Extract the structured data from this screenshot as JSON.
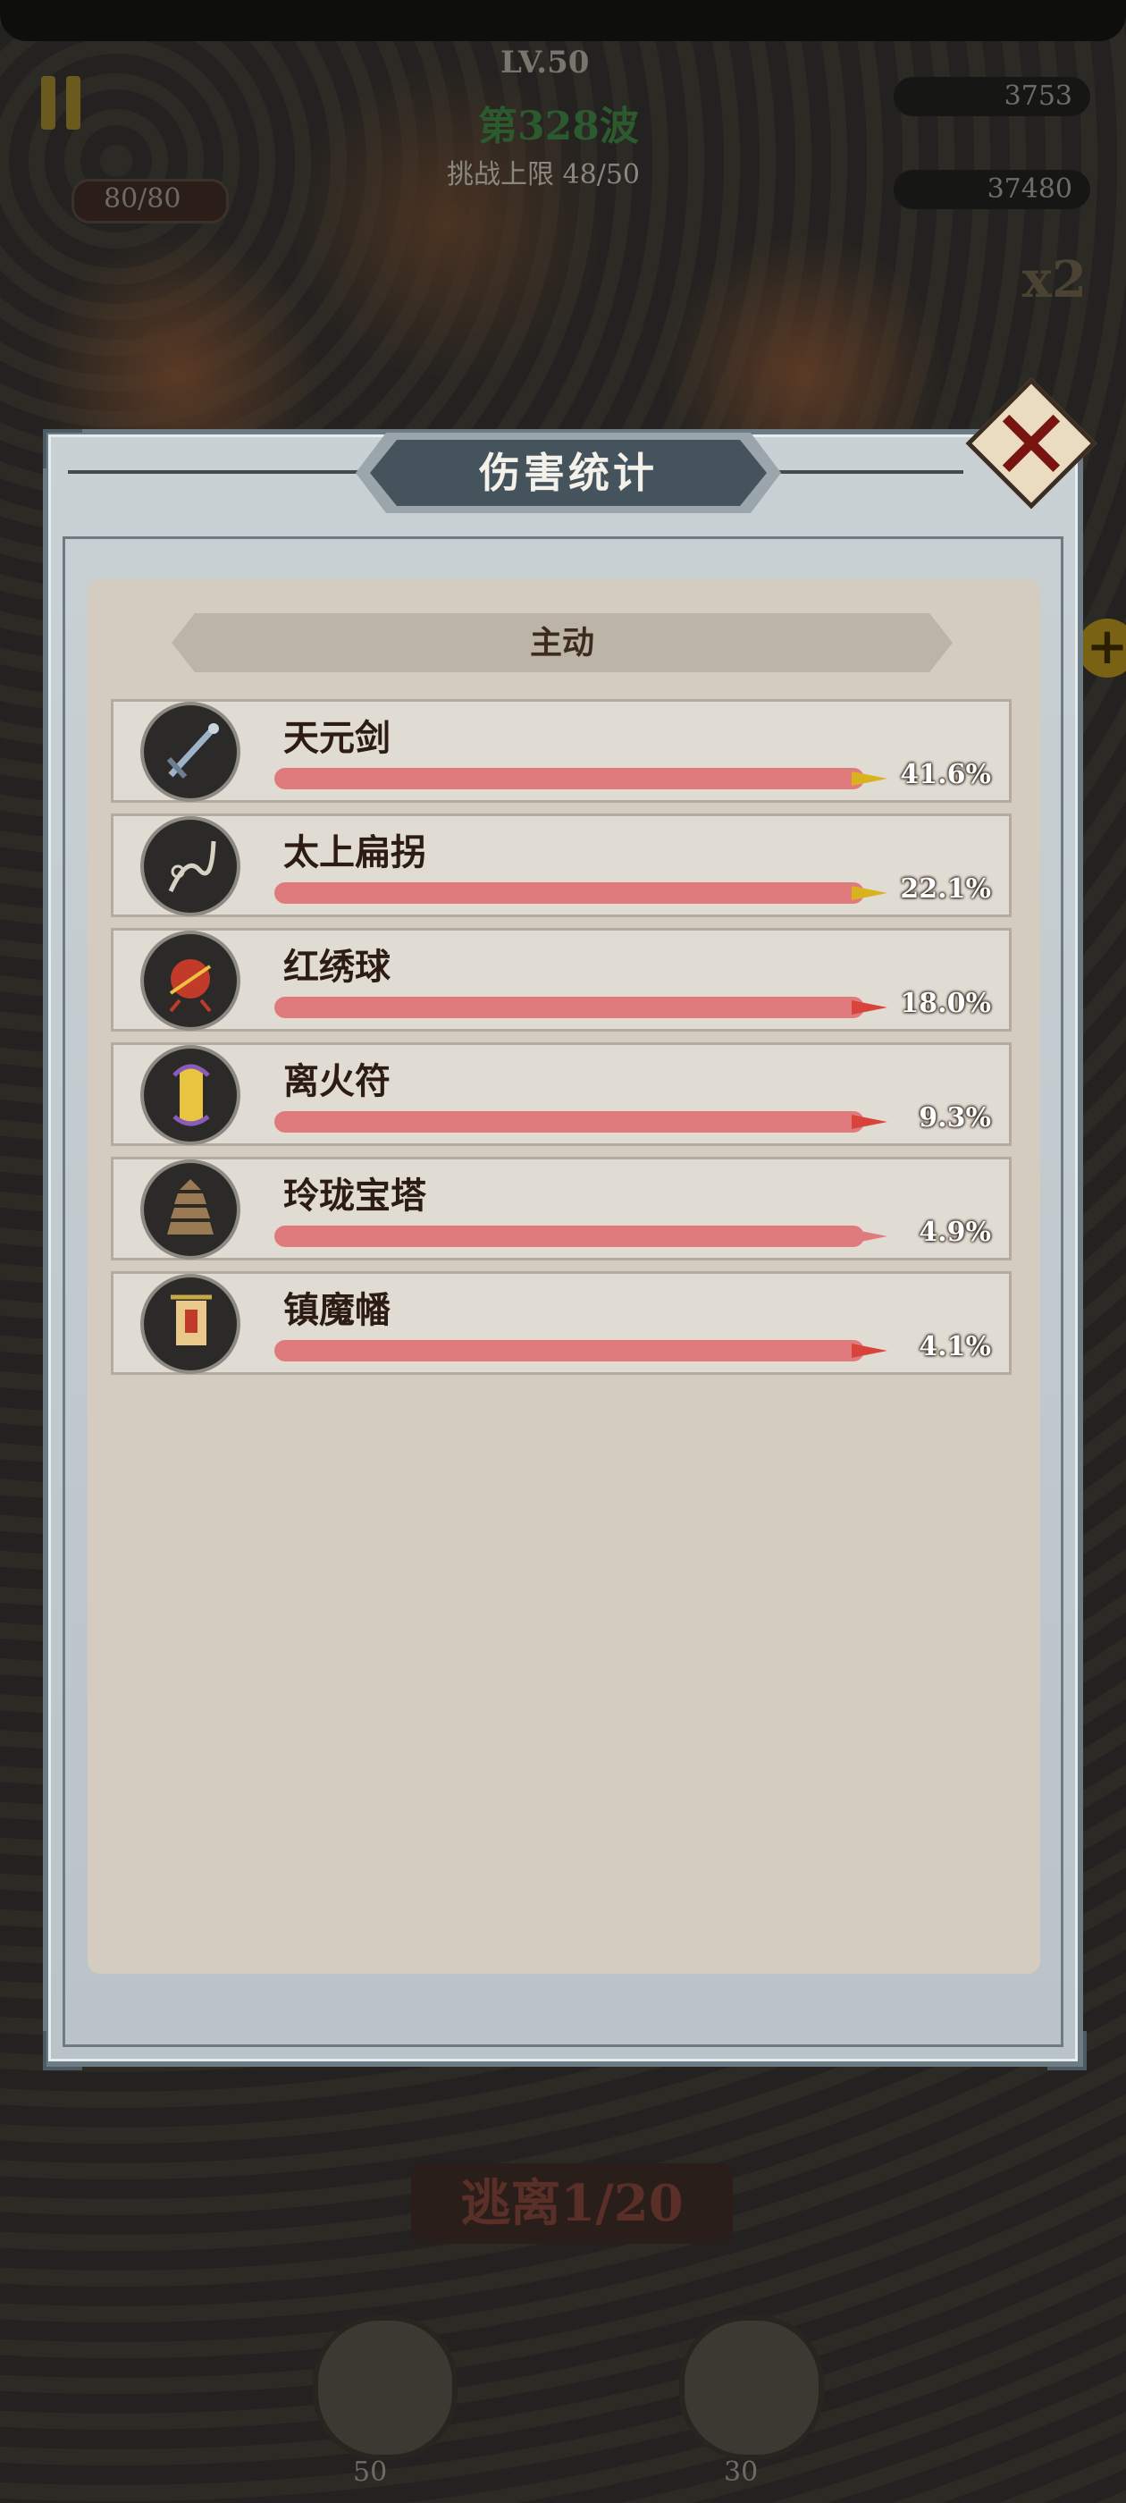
{
  "hud": {
    "level": "LV.50",
    "wave": "第328波",
    "challenge_limit": "挑战上限 48/50",
    "hp": "80/80",
    "coins": "3753",
    "gems": "37480",
    "speed": "x2"
  },
  "dialog": {
    "title": "伤害统计",
    "section": "主动",
    "items": [
      {
        "name": "天元剑",
        "percent_label": "41.6%",
        "percent": 41.6,
        "tip_color": "#d9b21e",
        "icon": "sword-icon"
      },
      {
        "name": "太上扁拐",
        "percent_label": "22.1%",
        "percent": 22.1,
        "tip_color": "#d9b21e",
        "icon": "staff-icon"
      },
      {
        "name": "红绣球",
        "percent_label": "18.0%",
        "percent": 18.0,
        "tip_color": "#d8443a",
        "icon": "embroidered-ball-icon"
      },
      {
        "name": "离火符",
        "percent_label": "9.3%",
        "percent": 9.3,
        "tip_color": "#d8443a",
        "icon": "fire-talisman-icon"
      },
      {
        "name": "玲珑宝塔",
        "percent_label": "4.9%",
        "percent": 4.9,
        "tip_color": "#e07b7d",
        "icon": "pagoda-icon"
      },
      {
        "name": "镇魔幡",
        "percent_label": "4.1%",
        "percent": 4.1,
        "tip_color": "#d8443a",
        "icon": "banner-icon"
      }
    ]
  },
  "footer": {
    "escape_label": "逃离1/20",
    "skill1_cost": "50",
    "skill2_cost": "30"
  }
}
